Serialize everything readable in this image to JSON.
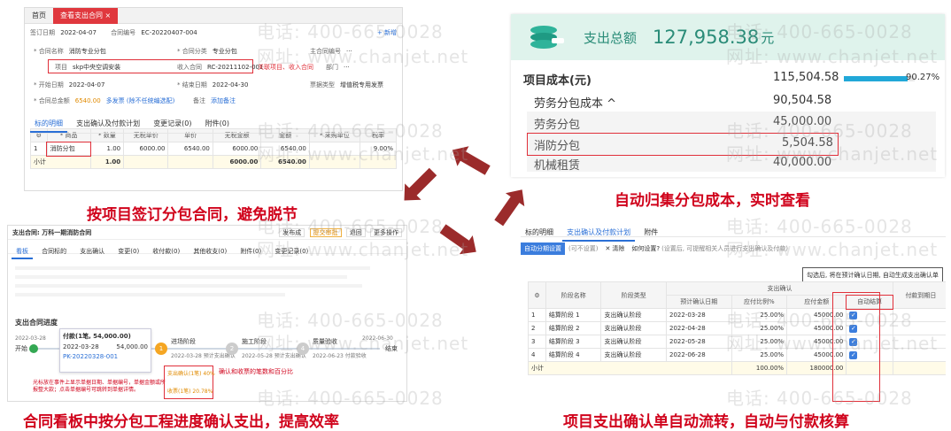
{
  "watermark": {
    "phone": "电话: 400-665-0028",
    "site": "网址: www.chanjet.net"
  },
  "captions": {
    "top_left": "按项目签订分包合同，避免脱节",
    "top_right": "自动归集分包成本，实时查看",
    "bottom_left": "合同看板中按分包工程进度确认支出，提高效率",
    "bottom_right": "项目支出确认单自动流转，自动与付款核算"
  },
  "contract_form": {
    "tabs": [
      "首页",
      "查看支出合同 ×"
    ],
    "new_btn": "+ 新增",
    "sign_date_label": "签订日期",
    "sign_date": "2022-04-07",
    "contract_no_label": "合同编号",
    "contract_no": "EC-20220407-004",
    "name_label": "* 合同名称",
    "name": "消防专业分包",
    "type_label": "* 合同分类",
    "type": "专业分包",
    "main_no_label": "主合同编号",
    "main_no": "···",
    "project_label": "项目",
    "project": "skp中央空调安装",
    "income_label": "收入合同",
    "income": "RC-20211102-001",
    "dept_label": "部门",
    "dept": "···",
    "note": "关联项目、收入合同",
    "start_label": "* 开始日期",
    "start": "2022-04-07",
    "end_label": "* 结束日期",
    "end": "2022-04-30",
    "invoice_label": "票据类型",
    "invoice": "增值税专用发票",
    "amount_label": "* 合同总金额",
    "amount": "6540.00",
    "amount_extra": "多发票 (除不任统编选配)",
    "remark_label": "备注",
    "attach": "添加备注",
    "sub_tabs": [
      "标的明细",
      "支出确认及付款计划",
      "变更记录(0)",
      "附件(0)"
    ],
    "table_headers": [
      "",
      "* 商品",
      "* 数量",
      "无税单价",
      "单价",
      "无税金额",
      "金额",
      "* 采购单位",
      "税率"
    ],
    "rows": [
      [
        "1",
        "消防分包",
        "1.00",
        "6000.00",
        "6540.00",
        "6000.00",
        "6540.00",
        "",
        "9.00%"
      ]
    ],
    "subtotal": [
      "小计",
      "1.00",
      "6000.00",
      "6540.00"
    ]
  },
  "cost_panel": {
    "total_label": "支出总额",
    "total_value": "127,958.38",
    "total_unit": "元",
    "items": [
      {
        "label": "项目成本(元)",
        "value": "115,504.58"
      },
      {
        "label": "劳务分包成本 ^",
        "value": "90,504.58"
      },
      {
        "label": "劳务分包",
        "value": "45,000.00"
      },
      {
        "label": "消防分包",
        "value": "5,504.58"
      },
      {
        "label": "机械租赁",
        "value": "40,000.00"
      }
    ],
    "percent": "90.27%",
    "percent_value": 0.9027
  },
  "board": {
    "title": "支出合同: 万科一期消防合同",
    "top_btns": [
      "发布成",
      "提交审批",
      "退回",
      "更多操作"
    ],
    "tabs": [
      "看板",
      "合同标的",
      "支出确认",
      "变更(0)",
      "收付款(0)",
      "其他收支(0)",
      "附件(0)",
      "变更记录(0)"
    ],
    "progress_title": "支出合同进度",
    "progress_note": "确认和收票的笔数和百分比",
    "nodes": [
      {
        "name": "付款(1笔, 54,000.00)",
        "date": "2022-03-28"
      },
      {
        "name": "进场阶段",
        "date": "2022-03-28 预计支出确认"
      },
      {
        "name": "施工阶段",
        "date": "2022-05-28 预计支出确认"
      },
      {
        "name": "质量验收",
        "date": "2022-06-23 付款验收"
      }
    ],
    "start_label": "开始",
    "end_label": "结束",
    "start_date": "2022-03-28",
    "end_date": "2022-06-30",
    "popup_date": "2022-03-28",
    "popup_amount": "54,000.00",
    "popup_link": "PK-20220328-001",
    "hint": "光标放在事件上显示单据日期、单据编号，单据金额或所报整大款；点击单据编号可跳转到单据详情。",
    "stat1": "支出确认(1笔) 40%",
    "stat2": "收票(1笔) 20.78%"
  },
  "confirm_table": {
    "tabs": [
      "标的明细",
      "支出确认及付款计划",
      "附件"
    ],
    "btn_auto": "自动分期设置",
    "btn_note": "(可不设置)",
    "clear": "清除",
    "how": "如何设置?",
    "how_note": "(设置后, 可提醒相关人员进行支出确认及付款)",
    "tip": "勾选后, 将在预计确认日期, 自动生成支出确认单",
    "group_header": "支出确认",
    "headers": [
      "",
      "阶段名称",
      "阶段类型",
      "预计确认日期",
      "应付比例%",
      "应付金额",
      "自动结算",
      "付款到期日"
    ],
    "rows": [
      [
        "1",
        "结算阶段 1",
        "支出确认阶段",
        "2022-03-28",
        "25.00%",
        "45000.00"
      ],
      [
        "2",
        "结算阶段 2",
        "支出确认阶段",
        "2022-04-28",
        "25.00%",
        "45000.00"
      ],
      [
        "3",
        "结算阶段 3",
        "支出确认阶段",
        "2022-05-28",
        "25.00%",
        "45000.00"
      ],
      [
        "4",
        "结算阶段 4",
        "支出确认阶段",
        "2022-06-28",
        "25.00%",
        "45000.00"
      ]
    ],
    "subtotal_label": "小计",
    "subtotal_pct": "100.00%",
    "subtotal_amt": "180000.00"
  }
}
